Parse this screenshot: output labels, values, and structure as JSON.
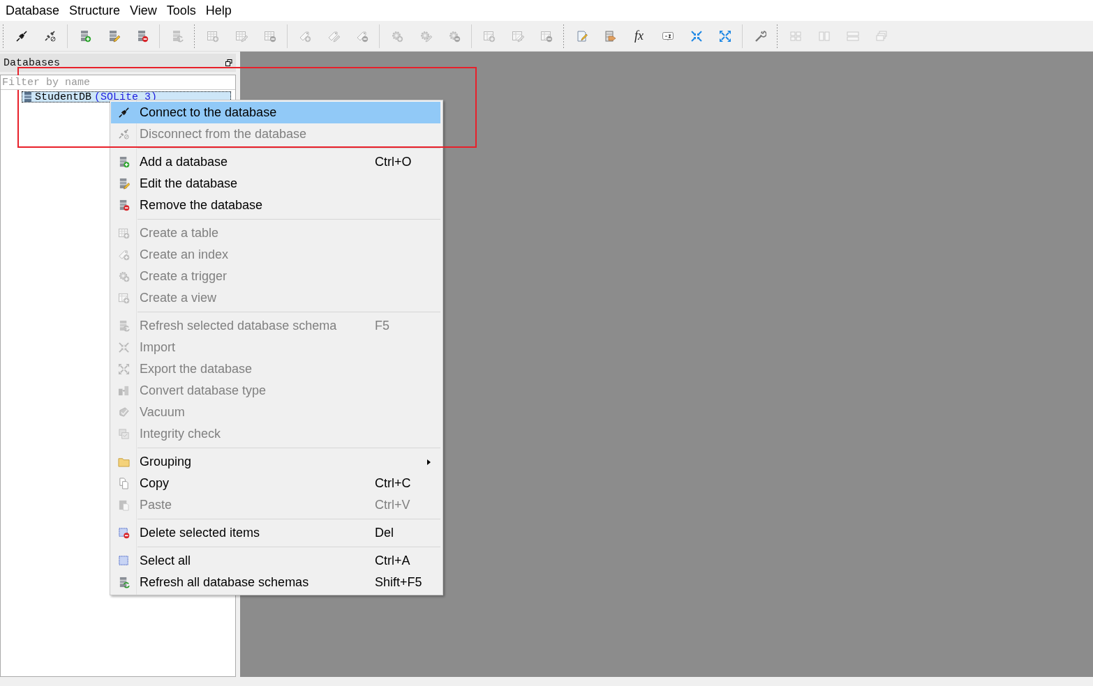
{
  "menubar": {
    "items": [
      {
        "label": "Database"
      },
      {
        "label": "Structure"
      },
      {
        "label": "View"
      },
      {
        "label": "Tools"
      },
      {
        "label": "Help"
      }
    ]
  },
  "toolbar": {
    "sections": [
      {
        "groups": [
          [
            {
              "kind": "plug",
              "disabled": false
            },
            {
              "kind": "plug-off",
              "disabled": false
            }
          ],
          [
            {
              "kind": "db-add",
              "disabled": false
            },
            {
              "kind": "db-edit",
              "disabled": false
            },
            {
              "kind": "db-remove",
              "disabled": false
            }
          ],
          [
            {
              "kind": "db-refresh",
              "disabled": true
            }
          ]
        ]
      },
      {
        "groups": [
          [
            {
              "kind": "table-add",
              "disabled": true
            },
            {
              "kind": "table-edit",
              "disabled": true
            },
            {
              "kind": "table-remove",
              "disabled": true
            }
          ],
          [
            {
              "kind": "index-add",
              "disabled": true
            },
            {
              "kind": "index-edit",
              "disabled": true
            },
            {
              "kind": "index-remove",
              "disabled": true
            }
          ],
          [
            {
              "kind": "trigger-add",
              "disabled": true
            },
            {
              "kind": "trigger-edit",
              "disabled": true
            },
            {
              "kind": "trigger-remove",
              "disabled": true
            }
          ],
          [
            {
              "kind": "view-add",
              "disabled": true
            },
            {
              "kind": "view-edit",
              "disabled": true
            },
            {
              "kind": "view-remove",
              "disabled": true
            }
          ]
        ]
      },
      {
        "groups": [
          [
            {
              "kind": "editor",
              "disabled": false
            },
            {
              "kind": "data-export",
              "disabled": false
            },
            {
              "kind": "text",
              "text": "fx",
              "disabled": false
            },
            {
              "kind": "sort",
              "disabled": false
            },
            {
              "kind": "import",
              "disabled": false
            },
            {
              "kind": "export",
              "disabled": false
            }
          ],
          [
            {
              "kind": "wrench",
              "disabled": false
            }
          ]
        ]
      },
      {
        "groups": [
          [
            {
              "kind": "tile",
              "disabled": true
            },
            {
              "kind": "columns",
              "disabled": true
            },
            {
              "kind": "rows",
              "disabled": true
            },
            {
              "kind": "cascade",
              "disabled": true
            }
          ]
        ]
      }
    ]
  },
  "databases_panel": {
    "title": "Databases",
    "filter": {
      "placeholder": "Filter by name"
    },
    "tree": [
      {
        "label": "StudentDB",
        "detail": "(SQLite 3)",
        "selected": true
      }
    ]
  },
  "context_menu": {
    "items": [
      {
        "kind": "item",
        "label": "Connect to the database",
        "disabled": false,
        "selected": true
      },
      {
        "kind": "item",
        "label": "Disconnect from the database",
        "disabled": true,
        "selected": false
      },
      {
        "kind": "separator"
      },
      {
        "kind": "item",
        "label": "Add a database",
        "shortcut": "Ctrl+O",
        "disabled": false,
        "selected": false
      },
      {
        "kind": "item",
        "label": "Edit the database",
        "disabled": false,
        "selected": false
      },
      {
        "kind": "item",
        "label": "Remove the database",
        "disabled": false,
        "selected": false
      },
      {
        "kind": "separator"
      },
      {
        "kind": "item",
        "label": "Create a table",
        "disabled": true,
        "selected": false
      },
      {
        "kind": "item",
        "label": "Create an index",
        "disabled": true,
        "selected": false
      },
      {
        "kind": "item",
        "label": "Create a trigger",
        "disabled": true,
        "selected": false
      },
      {
        "kind": "item",
        "label": "Create a view",
        "disabled": true,
        "selected": false
      },
      {
        "kind": "separator"
      },
      {
        "kind": "item",
        "label": "Refresh selected database schema",
        "shortcut": "F5",
        "disabled": true,
        "selected": false
      },
      {
        "kind": "item",
        "label": "Import",
        "disabled": true,
        "selected": false
      },
      {
        "kind": "item",
        "label": "Export the database",
        "disabled": true,
        "selected": false
      },
      {
        "kind": "item",
        "label": "Convert database type",
        "disabled": true,
        "selected": false
      },
      {
        "kind": "item",
        "label": "Vacuum",
        "disabled": true,
        "selected": false
      },
      {
        "kind": "item",
        "label": "Integrity check",
        "disabled": true,
        "selected": false
      },
      {
        "kind": "separator"
      },
      {
        "kind": "item",
        "label": "Grouping",
        "submenu": true,
        "disabled": false,
        "selected": false
      },
      {
        "kind": "item",
        "label": "Copy",
        "shortcut": "Ctrl+C",
        "disabled": false,
        "selected": false
      },
      {
        "kind": "item",
        "label": "Paste",
        "shortcut": "Ctrl+V",
        "disabled": true,
        "selected": false
      },
      {
        "kind": "separator"
      },
      {
        "kind": "item",
        "label": "Delete selected items",
        "shortcut": "Del",
        "disabled": false,
        "selected": false
      },
      {
        "kind": "separator"
      },
      {
        "kind": "item",
        "label": "Select all",
        "shortcut": "Ctrl+A",
        "disabled": false,
        "selected": false
      },
      {
        "kind": "item",
        "label": "Refresh all database schemas",
        "shortcut": "Shift+F5",
        "disabled": false,
        "selected": false
      }
    ]
  }
}
